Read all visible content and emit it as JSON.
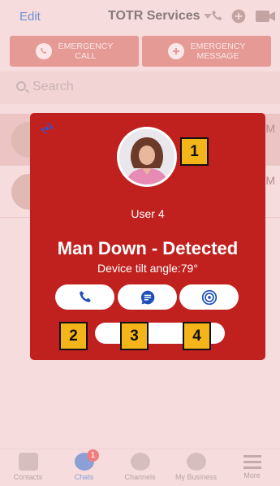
{
  "header": {
    "edit_label": "Edit",
    "service_name": "TOTR Services",
    "icons": [
      "phone-icon",
      "new-message-icon",
      "video-icon"
    ]
  },
  "emergency": {
    "call_line1": "EMERGENCY",
    "call_line2": "CALL",
    "message_line1": "EMERGENCY",
    "message_line2": "MESSAGE"
  },
  "search": {
    "placeholder": "Search"
  },
  "chat_rows": [
    {
      "time_suffix": "M"
    },
    {
      "time_suffix": "M"
    }
  ],
  "alert": {
    "user_name": "User 4",
    "status": "Man Down - Detected",
    "tilt_text": "Device tilt angle:79°",
    "actions": [
      "call-icon",
      "chat-icon",
      "locate-icon"
    ]
  },
  "callouts": [
    "1",
    "2",
    "3",
    "4"
  ],
  "tabs": [
    {
      "label": "Contacts",
      "badge": ""
    },
    {
      "label": "Chats",
      "badge": "1"
    },
    {
      "label": "Channels",
      "badge": ""
    },
    {
      "label": "My Business",
      "badge": ""
    },
    {
      "label": "More",
      "badge": ""
    }
  ],
  "colors": {
    "alert_red": "#c0211f",
    "accent_blue": "#1f4fb8",
    "callout_yellow": "#f4b51b"
  }
}
